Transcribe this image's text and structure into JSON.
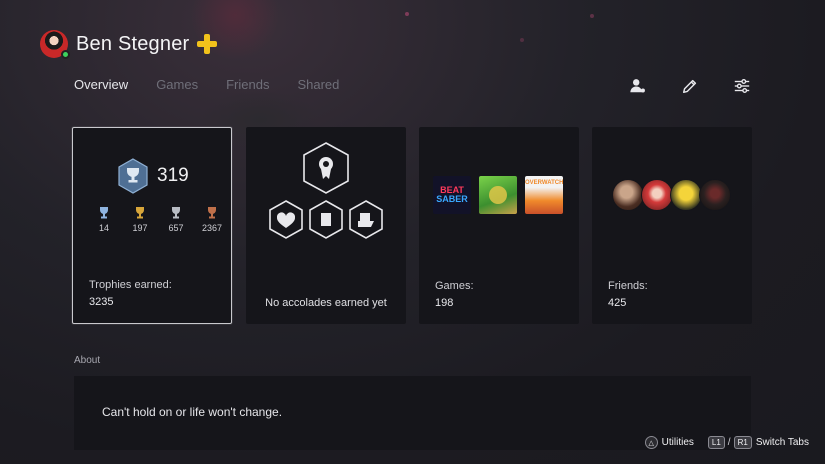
{
  "profile": {
    "username": "Ben Stegner",
    "online_color": "#3dd15d",
    "plus_color": "#f2c21b"
  },
  "tabs": [
    {
      "label": "Overview",
      "active": true
    },
    {
      "label": "Games",
      "active": false
    },
    {
      "label": "Friends",
      "active": false
    },
    {
      "label": "Shared",
      "active": false
    }
  ],
  "actions": [
    {
      "icon": "add-friend-icon"
    },
    {
      "icon": "pencil-icon"
    },
    {
      "icon": "sliders-icon"
    }
  ],
  "trophies": {
    "level": "319",
    "platinum": "14",
    "gold": "197",
    "silver": "657",
    "bronze": "2367",
    "label": "Trophies earned:",
    "total": "3235"
  },
  "accolades": {
    "empty_text": "No accolades earned yet"
  },
  "games": {
    "thumb_1": {
      "line1": "BEAT",
      "line2": "SABER"
    },
    "thumb_3": {
      "text": "OVERWATCH"
    },
    "label": "Games:",
    "count": "198"
  },
  "friends": {
    "label": "Friends:",
    "count": "425"
  },
  "about": {
    "label": "About",
    "text": "Can't hold on or life won't change."
  },
  "footer": {
    "utilities_glyph": "△",
    "utilities_label": "Utilities",
    "l1": "L1",
    "slash": "/",
    "r1": "R1",
    "switch_label": "Switch Tabs"
  }
}
